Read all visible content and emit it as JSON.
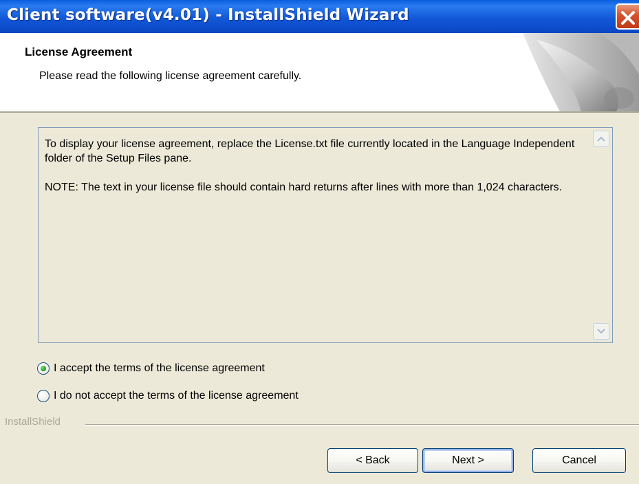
{
  "window": {
    "title": "Client software(v4.01) - InstallShield Wizard"
  },
  "header": {
    "title": "License Agreement",
    "subtitle": "Please read the following license agreement carefully."
  },
  "license": {
    "paragraphs": [
      "To display your license agreement, replace the License.txt file currently located in the Language Independent folder of the Setup Files pane.",
      "NOTE: The text in your license file should contain hard returns after lines with more than 1,024 characters."
    ]
  },
  "options": {
    "accept_label": "I accept the terms of the license agreement",
    "decline_label": "I do not accept the terms of the license agreement",
    "selected": "accept"
  },
  "footer": {
    "brand": "InstallShield"
  },
  "buttons": {
    "back": "< Back",
    "next": "Next >",
    "cancel": "Cancel"
  },
  "colors": {
    "titlebar": "#0a46c4",
    "close": "#d5512d",
    "dialog_bg": "#ece9d8",
    "selected_radio": "#21a121"
  },
  "icons": {
    "close": "close-icon",
    "scroll_up": "chevron-up-icon",
    "scroll_down": "chevron-down-icon",
    "header_art": "page-curl-graphic"
  }
}
